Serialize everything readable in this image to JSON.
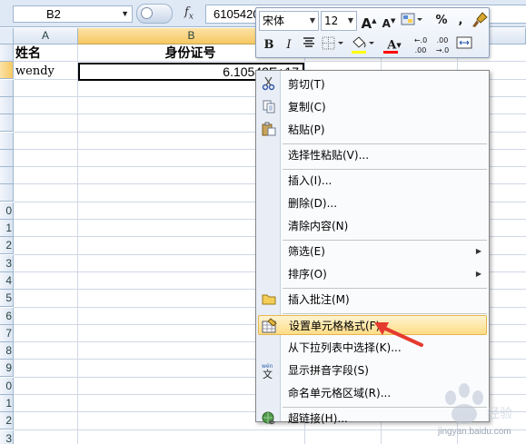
{
  "formula_bar": {
    "name_box": "B2",
    "formula_value": "61054200"
  },
  "columns": [
    {
      "label": "A",
      "selected": false
    },
    {
      "label": "B",
      "selected": true
    }
  ],
  "row_headers": [
    "",
    "",
    "",
    "",
    "",
    "",
    "",
    "",
    "",
    "0",
    "1",
    "2",
    "3",
    "4",
    "5",
    "6",
    "7",
    "8",
    "9",
    "0",
    "1",
    "2",
    "3"
  ],
  "cells": {
    "a1": "姓名",
    "b1": "身份证号",
    "a2": "wendy",
    "b2": "6.10542E+17"
  },
  "mini_toolbar": {
    "font_name": "宋体",
    "font_size": "12",
    "grow_font": "A",
    "shrink_font": "A",
    "percent": "%",
    "comma": ",",
    "bold": "B",
    "italic": "I",
    "font_color_letter": "A",
    "increase_decimal": "←.0\n.00",
    "decrease_decimal": ".00\n→.0",
    "fill_color": "#ffff00",
    "font_color": "#ff0000"
  },
  "context_menu": {
    "items": [
      {
        "label": "剪切(T)",
        "icon": "scissors-icon"
      },
      {
        "label": "复制(C)",
        "icon": "copy-icon"
      },
      {
        "label": "粘贴(P)",
        "icon": "paste-icon"
      },
      {
        "label": "选择性粘贴(V)...",
        "icon": ""
      },
      {
        "label": "插入(I)...",
        "icon": ""
      },
      {
        "label": "删除(D)...",
        "icon": ""
      },
      {
        "label": "清除内容(N)",
        "icon": ""
      },
      {
        "label": "筛选(E)",
        "icon": "",
        "submenu": true
      },
      {
        "label": "排序(O)",
        "icon": "",
        "submenu": true
      },
      {
        "label": "插入批注(M)",
        "icon": "comment-icon"
      },
      {
        "label": "设置单元格格式(F)...",
        "icon": "format-cells-icon",
        "highlighted": true
      },
      {
        "label": "从下拉列表中选择(K)...",
        "icon": ""
      },
      {
        "label": "显示拼音字段(S)",
        "icon": "phonetic-icon"
      },
      {
        "label": "命名单元格区域(R)...",
        "icon": ""
      },
      {
        "label": "超链接(H)...",
        "icon": "hyperlink-icon"
      }
    ],
    "highlight_color": "#fddc86",
    "arrow_color": "#e53a2e"
  },
  "watermark": {
    "text": "jingyan.baidu.com"
  }
}
